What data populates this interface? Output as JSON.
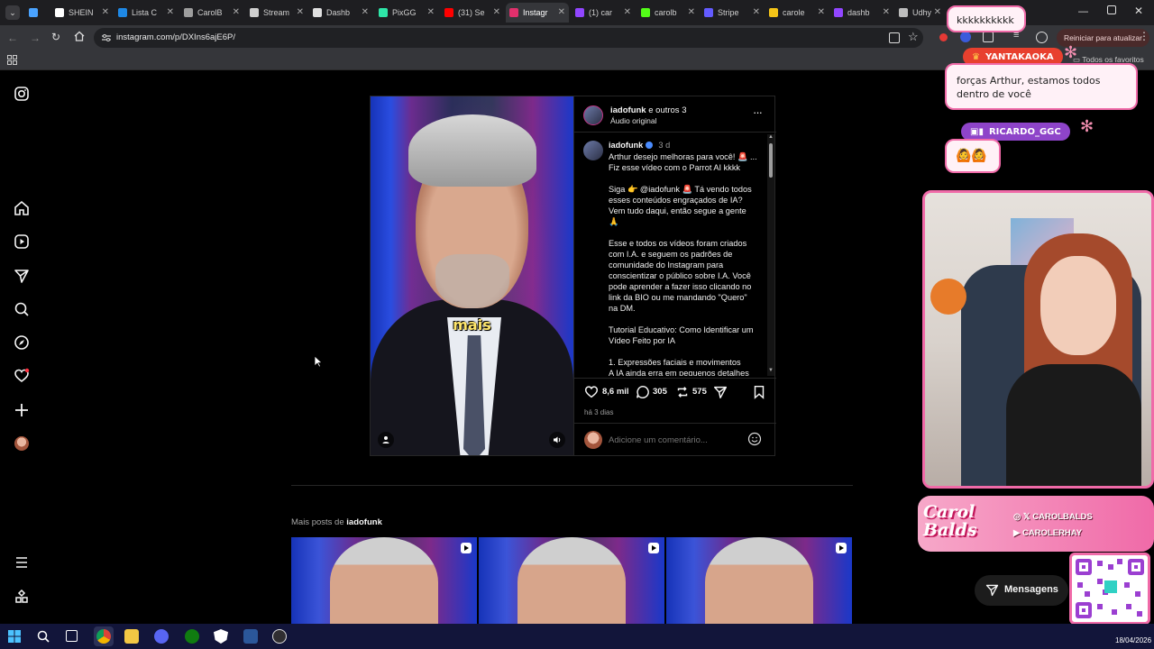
{
  "browser": {
    "tabs": [
      {
        "label": "",
        "color": "#4aa3ff"
      },
      {
        "label": "SHEIN",
        "color": "#ffffff"
      },
      {
        "label": "Lista C",
        "color": "#1e88e5"
      },
      {
        "label": "CarolB",
        "color": "#9e9e9e"
      },
      {
        "label": "Stream",
        "color": "#cfcfcf"
      },
      {
        "label": "Dashb",
        "color": "#e0e0e0"
      },
      {
        "label": "PixGG",
        "color": "#2ee6a8"
      },
      {
        "label": "(31) Se",
        "color": "#ff0000"
      },
      {
        "label": "Instagr",
        "color": "#e1306c"
      },
      {
        "label": "(1) car",
        "color": "#9146ff"
      },
      {
        "label": "carolb",
        "color": "#53fc18"
      },
      {
        "label": "Stripe",
        "color": "#635bff"
      },
      {
        "label": "carole",
        "color": "#f5c518"
      },
      {
        "label": "dashb",
        "color": "#9146ff"
      },
      {
        "label": "Udhy",
        "color": "#bdbdbd"
      }
    ],
    "url": "instagram.com/p/DXIns6ajE6P/",
    "restart_label": "Reiniciar para atualizar",
    "favorites_label": "Todos os favoritos"
  },
  "post": {
    "header": {
      "user": "iadofunk",
      "others": "e outros 3",
      "audio": "Áudio original"
    },
    "video_caption": "mais",
    "caption_author": "iadofunk",
    "caption_time": "3 d",
    "caption_lines": [
      "Arthur desejo melhoras para você! 🚨 ...",
      "Fiz esse vídeo com o Parrot AI kkkk",
      "",
      "Siga 👉 @iadofunk 🚨 Tá vendo todos",
      "esses conteúdos engraçados de IA?",
      "Vem tudo daqui, então segue a gente",
      "🙏",
      "",
      "Esse e todos os vídeos foram criados",
      "com I.A. e seguem os padrões de",
      "comunidade do Instagram para",
      "conscientizar o público sobre I.A. Você",
      "pode aprender a fazer isso clicando no",
      "link da BIO ou me mandando \"Quero\"",
      "na DM.",
      "",
      "Tutorial Educativo: Como Identificar um",
      "Vídeo Feito por IA",
      "",
      "1. Expressões faciais e movimentos",
      "A IA ainda erra em pequenos detalhes"
    ],
    "likes": "8,6 mil",
    "comments": "305",
    "reposts": "575",
    "posted_ago": "há 3 dias",
    "comment_placeholder": "Adicione um comentário..."
  },
  "more_posts": {
    "prefix": "Mais posts de",
    "user": "iadofunk"
  },
  "messages_label": "Mensagens",
  "overlay": {
    "chat": [
      {
        "user": "",
        "text": "kkkkkkkkkk"
      },
      {
        "user": "YANTAKAOKA",
        "text": "forças Arthur, estamos todos dentro de você"
      },
      {
        "user": "RICARDO_GGC",
        "text": "🙆🙆"
      }
    ],
    "brand": "Carol Balds",
    "socials": [
      "CAROLBALDS",
      "CAROLERHAY"
    ]
  },
  "taskbar": {
    "date": "18/04/2026"
  },
  "colors": {
    "accent_pink": "#f06aa8",
    "ig_blue": "#4a8cff",
    "taskbar": "#12153a"
  }
}
